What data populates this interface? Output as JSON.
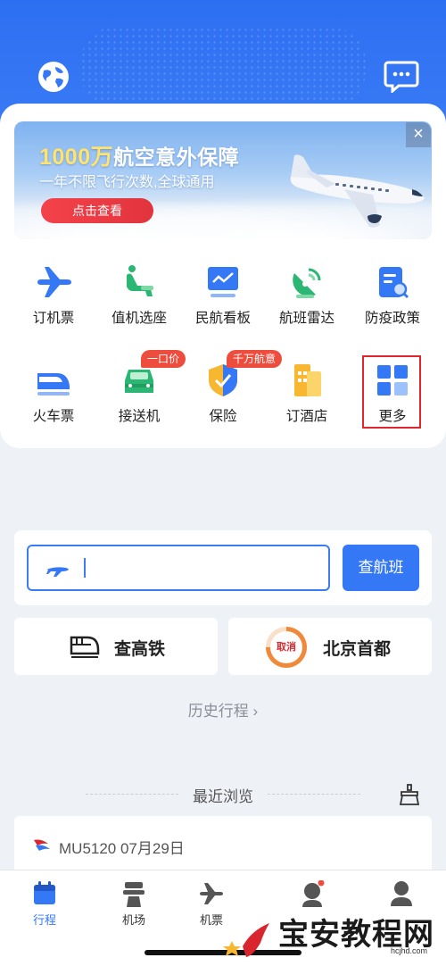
{
  "header": {
    "left_icon": "globe-icon",
    "right_icon": "chat-bubble-icon",
    "colors": {
      "primary": "#3478f6",
      "accent_red": "#e0262d"
    }
  },
  "banner": {
    "title_num": "1000万",
    "title_rest": "航空意外保障",
    "subtitle": "一年不限飞行次数,全球通用",
    "button": "点击查看",
    "close": "×"
  },
  "grid": {
    "row1": [
      {
        "label": "订机票",
        "icon": "airplane-icon"
      },
      {
        "label": "值机选座",
        "icon": "seat-icon"
      },
      {
        "label": "民航看板",
        "icon": "dashboard-icon"
      },
      {
        "label": "航班雷达",
        "icon": "radar-icon"
      },
      {
        "label": "防疫政策",
        "icon": "policy-search-icon"
      }
    ],
    "row2": [
      {
        "label": "火车票",
        "icon": "train-icon"
      },
      {
        "label": "接送机",
        "icon": "car-icon",
        "tag": "一口价"
      },
      {
        "label": "保险",
        "icon": "shield-icon",
        "tag": "千万航意"
      },
      {
        "label": "订酒店",
        "icon": "hotel-icon"
      },
      {
        "label": "更多",
        "icon": "more-grid-icon"
      }
    ]
  },
  "search": {
    "placeholder": "",
    "button": "查航班"
  },
  "quick": {
    "train": "查高铁",
    "airport_badge": "取消",
    "airport": "北京首都"
  },
  "history": "历史行程 ›",
  "recent": {
    "title": "最近浏览",
    "flight": "MU5120 07月29日"
  },
  "tabs": [
    {
      "label": "行程",
      "icon": "calendar-icon",
      "active": true
    },
    {
      "label": "机场",
      "icon": "control-tower-icon",
      "active": false
    },
    {
      "label": "机票",
      "icon": "airplane-icon",
      "active": false
    },
    {
      "label": "",
      "icon": "service-agent-icon",
      "active": false
    },
    {
      "label": "",
      "icon": "profile-icon",
      "active": false
    }
  ],
  "watermark": {
    "text": "宝安教程网",
    "url": "hcjhd.com"
  }
}
